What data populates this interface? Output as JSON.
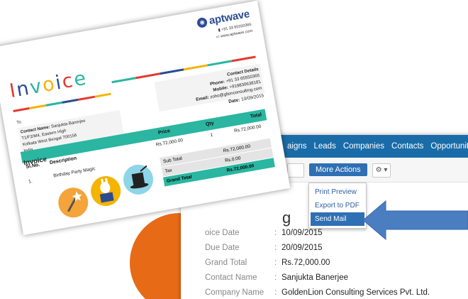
{
  "crm": {
    "nav_items": [
      "aigns",
      "Leads",
      "Companies",
      "Contacts",
      "Opportunities"
    ],
    "toolbar": {
      "more_actions_label": "More Actions",
      "gear_label": "⚙ ▾"
    },
    "dropdown": {
      "items": [
        "Print Preview",
        "Export to PDF",
        "Send Mail"
      ],
      "active": "Send Mail"
    },
    "heading_fragment": "g",
    "details": [
      {
        "label": "oice Date",
        "value": "10/09/2015"
      },
      {
        "label": "Due Date",
        "value": "20/09/2015"
      },
      {
        "label": "Grand Total",
        "value": "Rs.72,000.00"
      },
      {
        "label": "Contact Name",
        "value": "Sanjukta Banerjee"
      },
      {
        "label": "Company Name",
        "value": "GoldenLion Consulting Services Pvt. Ltd."
      }
    ],
    "colon": ":"
  },
  "invoice": {
    "brand": "aptwave",
    "brand_phone": "+91 33 65550365",
    "brand_web": "www.aptwave.com",
    "title": "Invoice",
    "title_colors": [
      "#e23a2e",
      "#2b4c93",
      "#2ab6a0",
      "#f4b400",
      "#2b4c93",
      "#e23a2e",
      "#2ab6a0"
    ],
    "to_label": "To",
    "contact_name_label": "Contact Name:",
    "contact_name": "Sanjukta Banerjee",
    "address_line1": "T1/F2/M4, Eastern High",
    "address_line2": "Kolkata West Bengal 700156",
    "address_line3": "India",
    "contact_details_title": "Contact Details",
    "phone_label": "Phone:",
    "phone": "+91 33 65550365",
    "mobile_label": "Mobile:",
    "mobile": "+919830638181",
    "email_label": "Email:",
    "email": "zoho@glionconsulting.com",
    "date_label": "Date:",
    "date": "10/09/2015",
    "section_title": "Invoice",
    "columns": {
      "slno": "Sl.No.",
      "description": "Description",
      "price": "Price",
      "qty": "Qty",
      "total": "Total"
    },
    "rows": [
      {
        "slno": "1.",
        "description": "Birthday Party Magic",
        "price": "Rs.72,000.00",
        "qty": "1",
        "total": "Rs.72,000.00"
      }
    ],
    "totals": {
      "subtotal_label": "Sub Total",
      "subtotal": "Rs.72,000.00",
      "tax_label": "Tax",
      "tax": "Rs.0.00",
      "grand_label": "Grand Total",
      "grand": "Rs.72,000.00"
    }
  },
  "colors": {
    "nav": "#1a6ca8",
    "accent": "#2f6fb3",
    "teal": "#2ab6a0",
    "orange": "#e76a17",
    "arrow": "#4a7ec1"
  }
}
